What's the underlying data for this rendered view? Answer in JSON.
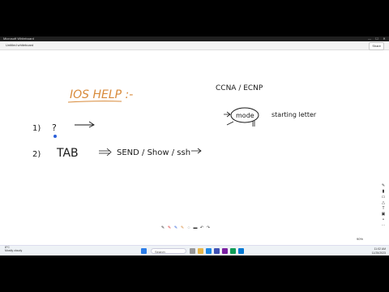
{
  "window": {
    "title": "Microsoft Whiteboard",
    "minimize": "—",
    "maximize": "☐",
    "close": "✕"
  },
  "tab": {
    "label": "Untitled whiteboard"
  },
  "share": {
    "label": "Share"
  },
  "ink": {
    "heading": "IOS HELP :-",
    "item1_number": "1)",
    "item1_symbol": "?",
    "item2_number": "2)",
    "item2_text": "TAB",
    "item2_detail": "SEND / Show / ssh",
    "right_title": "CCNA / ECNP",
    "right_circled": "mode",
    "right_extra": "starting letter"
  },
  "zoom": {
    "label": "90%"
  },
  "notification": {
    "line1": "8°C",
    "line2": "Mostly cloudy"
  },
  "taskbar": {
    "search_placeholder": "Search",
    "time": "11:02 AM",
    "date": "11/25/2023"
  },
  "colors": {
    "heading": "#d88a3a",
    "ink": "#1a1a1a",
    "circle": "#1a1a1a",
    "accent": "#2b5fd9"
  }
}
